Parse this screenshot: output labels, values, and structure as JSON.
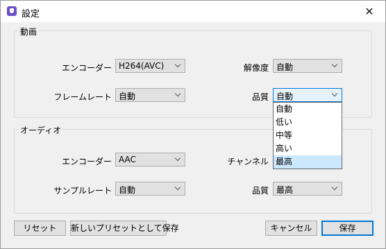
{
  "window": {
    "title": "設定",
    "icon": "app-shield-icon",
    "close_glyph": "✕"
  },
  "video": {
    "group_title": "動画",
    "encoder": {
      "label": "エンコーダー",
      "value": "H264(AVC)"
    },
    "resolution": {
      "label": "解像度",
      "value": "自動"
    },
    "framerate": {
      "label": "フレームレート",
      "value": "自動"
    },
    "quality": {
      "label": "品質",
      "value": "自動",
      "options": [
        "自動",
        "低い",
        "中等",
        "高い",
        "最高"
      ],
      "highlighted": "最高"
    }
  },
  "audio": {
    "group_title": "オーディオ",
    "encoder": {
      "label": "エンコーダー",
      "value": "AAC"
    },
    "channel": {
      "label": "チャンネル"
    },
    "samplerate": {
      "label": "サンプルレート",
      "value": "自動"
    },
    "quality": {
      "label": "品質",
      "value": "最高"
    }
  },
  "buttons": {
    "reset": "リセット",
    "save_as_preset": "新しいプリセットとして保存",
    "cancel": "キャンセル",
    "save": "保存"
  },
  "colors": {
    "accent": "#0078d7",
    "highlight": "#cce8ff",
    "app_icon": "#6b4fc8"
  }
}
